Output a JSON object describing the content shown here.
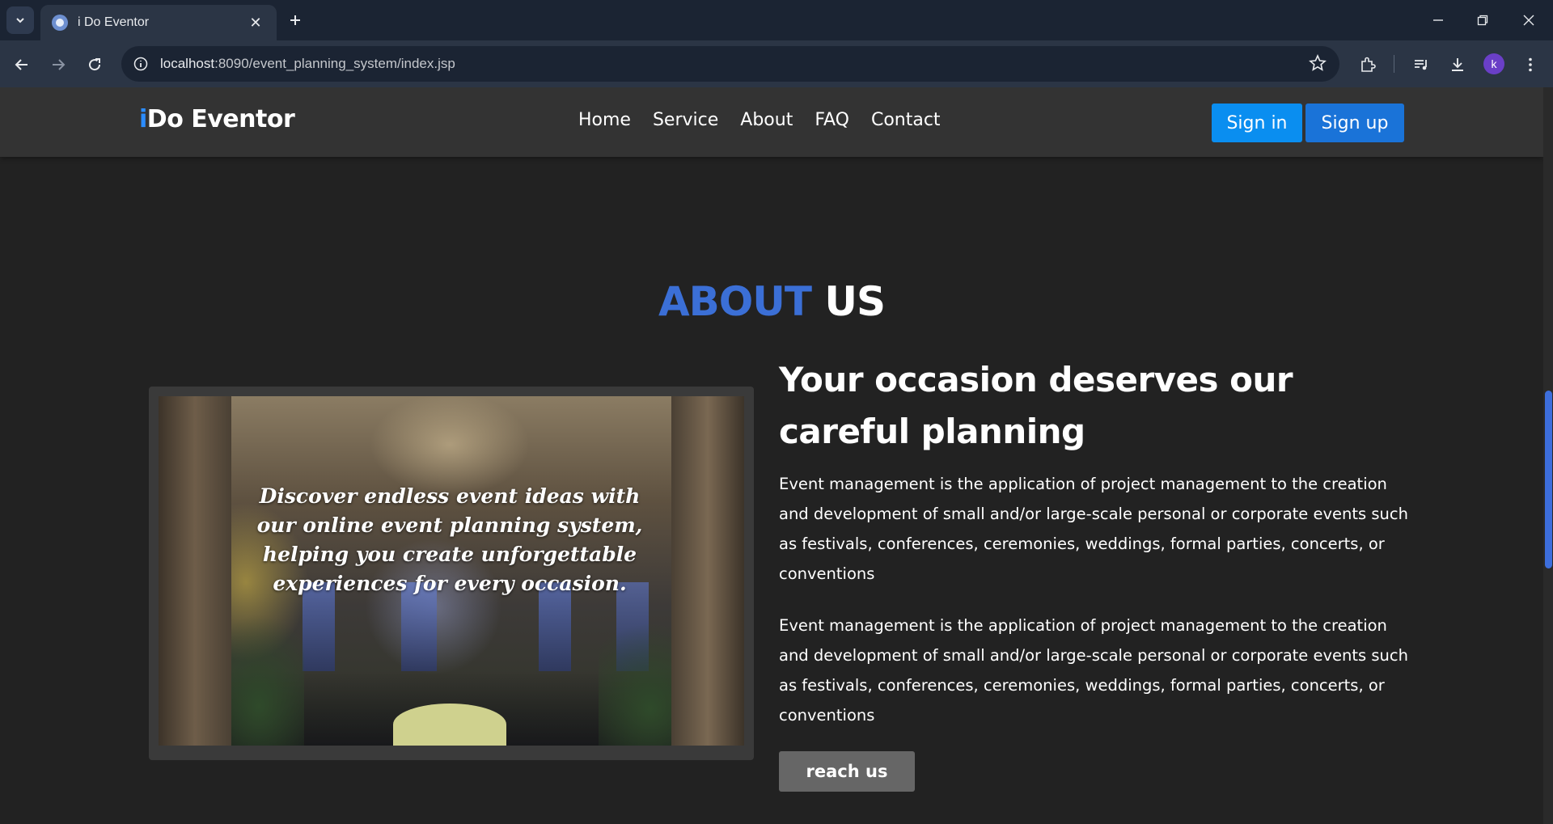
{
  "browser": {
    "tab_title": "i Do Eventor",
    "tab_close": "✕",
    "new_tab": "+",
    "url_host": "localhost",
    "url_path": ":8090/event_planning_system/index.jsp",
    "profile_initial": "k"
  },
  "site": {
    "logo_i": "i",
    "logo_rest": "Do Eventor",
    "nav": [
      "Home",
      "Service",
      "About",
      "FAQ",
      "Contact"
    ],
    "signin_label": "Sign in",
    "signup_label": "Sign up"
  },
  "about": {
    "heading_highlight": "ABOUT",
    "heading_rest": "US",
    "image_caption": "Discover endless event ideas with our online event planning system, helping you create unforgettable experiences for every occasion.",
    "title": "Your occasion deserves our careful planning",
    "paragraph_1": "Event management is the application of project management to the creation and development of small and/or large-scale personal or corporate events such as festivals, conferences, ceremonies, weddings, formal parties, concerts, or conventions",
    "paragraph_2": "Event management is the application of project management to the creation and development of small and/or large-scale personal or corporate events such as festivals, conferences, ceremonies, weddings, formal parties, concerts, or conventions",
    "reach_label": "reach us"
  },
  "colors": {
    "accent_blue": "#3b6fd6",
    "signin_bg": "#0a8ef0",
    "signup_bg": "#1a73d8",
    "page_bg": "#222222",
    "header_bg": "#333333"
  }
}
